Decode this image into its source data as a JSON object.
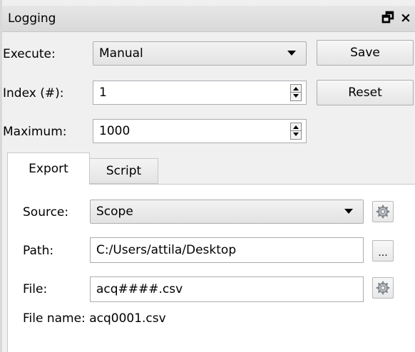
{
  "panel": {
    "title": "Logging",
    "float_glyph": "🗗",
    "close_glyph": "×"
  },
  "execute": {
    "label": "Execute:",
    "value": "Manual"
  },
  "index": {
    "label": "Index (#):",
    "value": "1"
  },
  "maximum": {
    "label": "Maximum:",
    "value": "1000"
  },
  "buttons": {
    "save": "Save",
    "reset": "Reset"
  },
  "tabs": [
    {
      "label": "Export",
      "active": true
    },
    {
      "label": "Script",
      "active": false
    }
  ],
  "export": {
    "source_label": "Source:",
    "source_value": "Scope",
    "path_label": "Path:",
    "path_value": "C:/Users/attila/Desktop",
    "browse_label": "...",
    "file_label": "File:",
    "file_value": "acq####.csv",
    "file_name_text": "File name: acq0001.csv"
  },
  "icons": {
    "source_settings": "gear-icon",
    "file_settings": "gear-icon"
  }
}
